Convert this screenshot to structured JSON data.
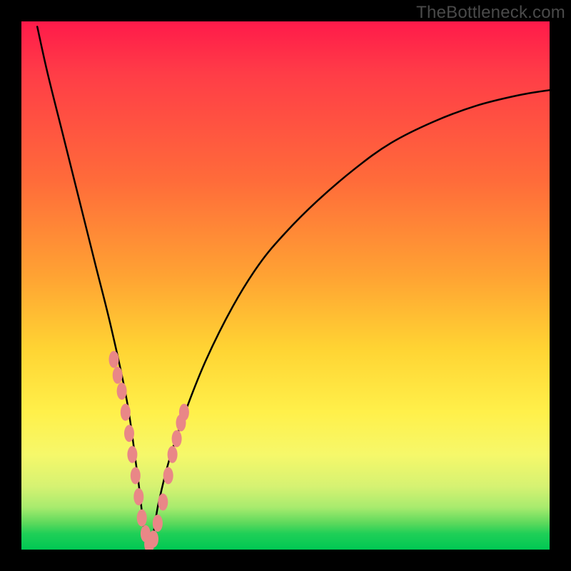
{
  "watermark": "TheBottleneck.com",
  "chart_data": {
    "type": "line",
    "title": "",
    "xlabel": "",
    "ylabel": "",
    "xlim": [
      0,
      100
    ],
    "ylim": [
      0,
      100
    ],
    "grid": false,
    "legend": false,
    "description": "Bottleneck percentage curve: low values (near zero) indicate balanced hardware; curve dips to zero around x≈24 and rises on both sides. Pink markers indicate tested/observed configurations near the minimum.",
    "series": [
      {
        "name": "bottleneck-curve",
        "x": [
          3,
          5,
          8,
          11,
          14,
          17,
          20,
          22,
          24,
          26,
          28,
          31,
          35,
          40,
          45,
          50,
          56,
          63,
          70,
          78,
          86,
          94,
          100
        ],
        "values": [
          99,
          90,
          78,
          66,
          54,
          42,
          28,
          14,
          0,
          9,
          17,
          26,
          36,
          46,
          54,
          60,
          66,
          72,
          77,
          81,
          84,
          86,
          87
        ]
      }
    ],
    "markers": {
      "name": "observed-points",
      "x": [
        17.5,
        18.2,
        19.0,
        19.7,
        20.4,
        21.0,
        21.6,
        22.2,
        22.8,
        23.5,
        24.2,
        25.0,
        25.8,
        26.8,
        27.8,
        28.6,
        29.4,
        30.2,
        30.8
      ],
      "values": [
        36,
        33,
        30,
        26,
        22,
        18,
        14,
        10,
        6,
        3,
        1,
        2,
        5,
        9,
        14,
        18,
        21,
        24,
        26
      ]
    },
    "gradient_stops": [
      {
        "pos": 0,
        "color": "#ff1a4a"
      },
      {
        "pos": 30,
        "color": "#ff6b3a"
      },
      {
        "pos": 62,
        "color": "#ffd433"
      },
      {
        "pos": 82,
        "color": "#f6f86a"
      },
      {
        "pos": 95,
        "color": "#5cd95c"
      },
      {
        "pos": 100,
        "color": "#00c853"
      }
    ]
  }
}
